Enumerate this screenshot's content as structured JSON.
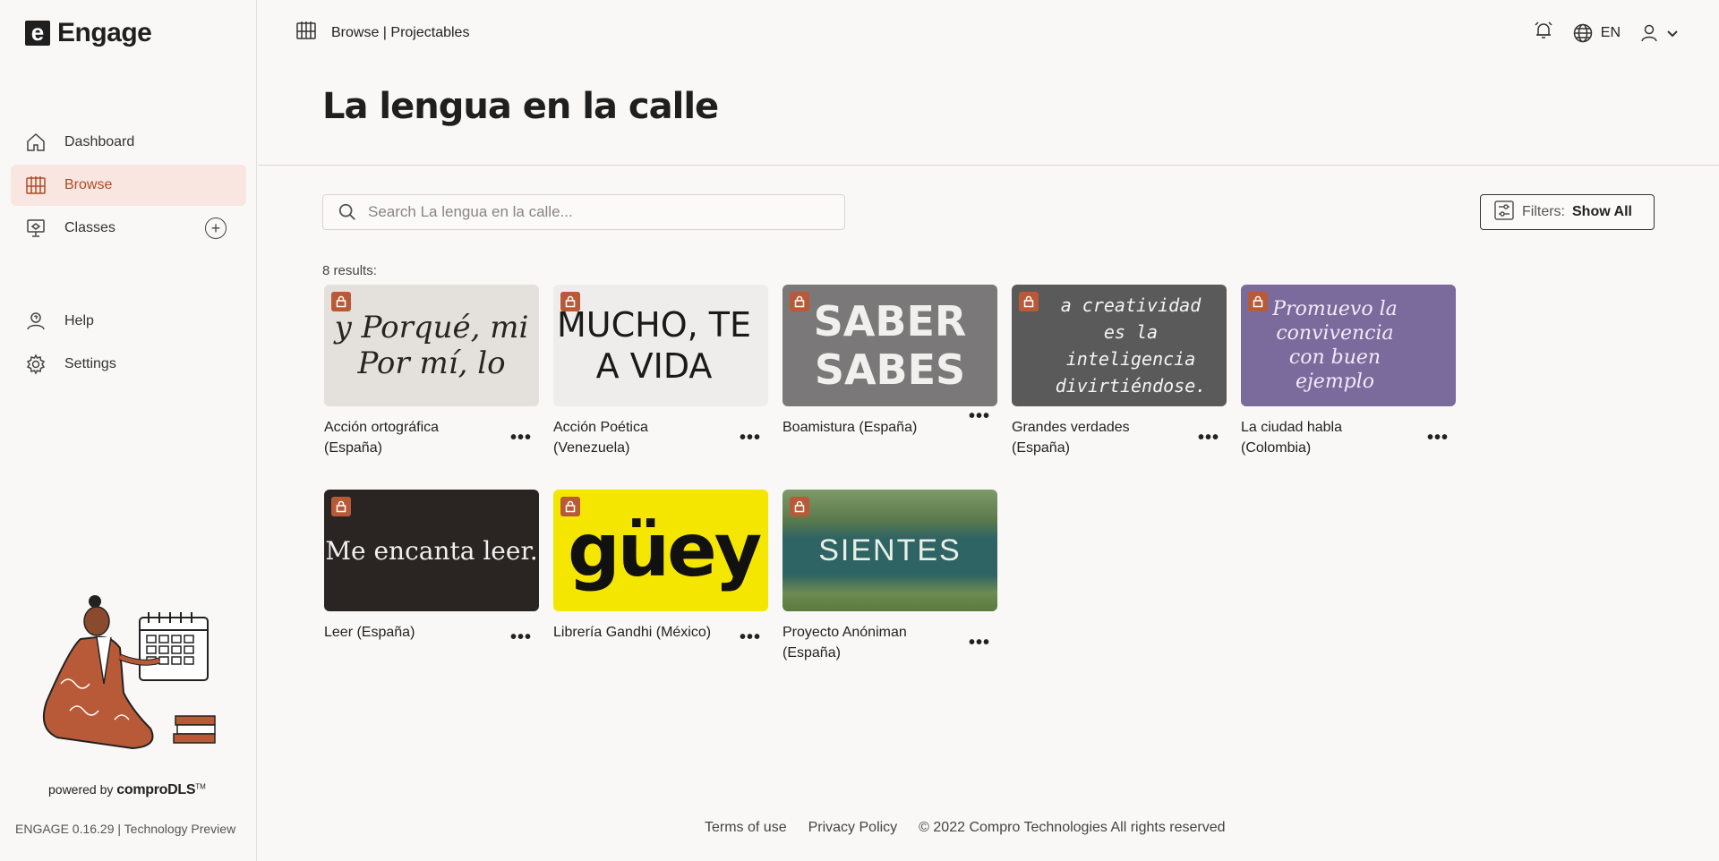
{
  "app": {
    "logo_letter": "e",
    "name": "Engage"
  },
  "nav": {
    "items": [
      {
        "label": "Dashboard",
        "icon": "home-icon"
      },
      {
        "label": "Browse",
        "icon": "browse-icon",
        "active": true
      },
      {
        "label": "Classes",
        "icon": "classes-icon"
      }
    ],
    "secondary": [
      {
        "label": "Help",
        "icon": "help-icon"
      },
      {
        "label": "Settings",
        "icon": "gear-icon"
      }
    ]
  },
  "powered": {
    "prefix": "powered by",
    "brand": "comproDLS",
    "tm": "TM"
  },
  "version": "ENGAGE 0.16.29 | Technology Preview",
  "topbar": {
    "breadcrumb": "Browse | Projectables",
    "language": "EN"
  },
  "page": {
    "title": "La lengua en la calle"
  },
  "search": {
    "placeholder": "Search La lengua en la calle..."
  },
  "filter": {
    "label": "Filters:",
    "value": "Show All"
  },
  "results_label": "8 results:",
  "cards": [
    {
      "title": "Acción ortográfica (España)",
      "thumb_text": "y Porqué, mi\nPor mí, lo"
    },
    {
      "title": "Acción Poética (Venezuela)",
      "thumb_text": "MUCHO, TE\nA VIDA"
    },
    {
      "title": "Boamistura (España)",
      "thumb_text": "SABER\nSABES"
    },
    {
      "title": "Grandes verdades (España)",
      "thumb_text": "a creatividad es la inteligencia divirtiéndose."
    },
    {
      "title": "La ciudad habla (Colombia)",
      "thumb_text": "Promuevo la convivencia con buen ejemplo"
    },
    {
      "title": "Leer (España)",
      "thumb_text": "Me encanta leer."
    },
    {
      "title": "Librería Gandhi (México)",
      "thumb_text": "güey"
    },
    {
      "title": "Proyecto Anóniman (España)",
      "thumb_text": "SIENTES"
    }
  ],
  "card_more": "•••",
  "footer": {
    "terms": "Terms of use",
    "privacy": "Privacy Policy",
    "copyright": "© 2022 Compro Technologies All rights reserved"
  },
  "colors": {
    "accent": "#b04a28",
    "active_bg": "#f9e6e0",
    "lock": "#b85a37"
  }
}
